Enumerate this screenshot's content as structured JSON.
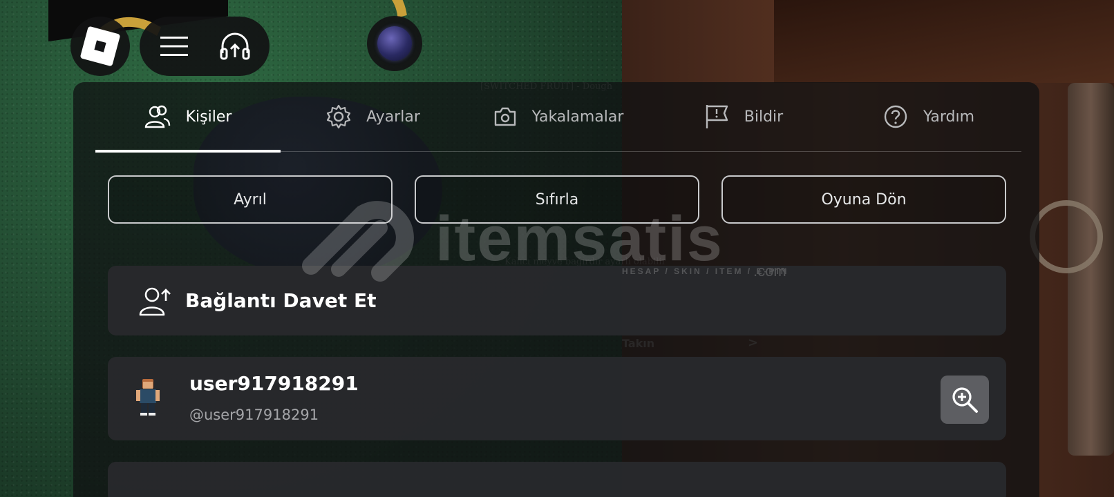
{
  "tabs": [
    {
      "label": "Kişiler",
      "icon": "people-icon",
      "active": true
    },
    {
      "label": "Ayarlar",
      "icon": "gear-icon",
      "active": false
    },
    {
      "label": "Yakalamalar",
      "icon": "camera-icon",
      "active": false
    },
    {
      "label": "Bildir",
      "icon": "flag-icon",
      "active": false
    },
    {
      "label": "Yardım",
      "icon": "help-icon",
      "active": false
    }
  ],
  "actions": {
    "leave": "Ayrıl",
    "reset": "Sıfırla",
    "resume": "Oyuna Dön"
  },
  "invite": {
    "label": "Bağlantı Davet Et",
    "icon": "add-friend-icon"
  },
  "player": {
    "display_name": "user917918291",
    "username": "@user917918291",
    "inspect_icon": "zoom-in-icon"
  },
  "top_bar": {
    "roblox_icon": "roblox-logo-icon",
    "menu_icon": "hamburger-menu-icon",
    "voice_icon": "headphones-icon",
    "avatar_icon": "user-avatar-orb"
  },
  "watermark": {
    "brand": "itemsatis",
    "sub": "HESAP / SKIN / ITEM / E-PIN",
    "dotcom": ".com"
  },
  "background_text": {
    "title": "[SWITCHED FRUIT] - Dough",
    "caption": "Kalıcı meyve bağırdır ayarlı olabilir",
    "equip": "Takın",
    "arrow": ">"
  },
  "colors": {
    "panel_bg": "#101113",
    "row_bg": "#28292c",
    "tab_active": "#ffffff",
    "tab_inactive": "#b8b9bb",
    "inspect_bg": "#5d5e62"
  }
}
